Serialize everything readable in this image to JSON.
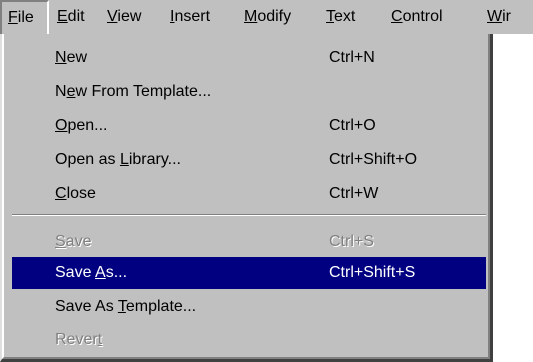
{
  "menubar": {
    "items": [
      {
        "pre": "",
        "key": "F",
        "post": "ile"
      },
      {
        "pre": "",
        "key": "E",
        "post": "dit"
      },
      {
        "pre": "",
        "key": "V",
        "post": "iew"
      },
      {
        "pre": "",
        "key": "I",
        "post": "nsert"
      },
      {
        "pre": "",
        "key": "M",
        "post": "odify"
      },
      {
        "pre": "",
        "key": "T",
        "post": "ext"
      },
      {
        "pre": "",
        "key": "C",
        "post": "ontrol"
      },
      {
        "pre": "",
        "key": "W",
        "post": "ir"
      }
    ]
  },
  "file_menu": {
    "items": [
      {
        "pre": "",
        "key": "N",
        "post": "ew",
        "shortcut": "Ctrl+N"
      },
      {
        "pre": "N",
        "key": "e",
        "post": "w From Template...",
        "shortcut": ""
      },
      {
        "pre": "",
        "key": "O",
        "post": "pen...",
        "shortcut": "Ctrl+O"
      },
      {
        "pre": "Open as ",
        "key": "L",
        "post": "ibrary...",
        "shortcut": "Ctrl+Shift+O"
      },
      {
        "pre": "",
        "key": "C",
        "post": "lose",
        "shortcut": "Ctrl+W"
      },
      {
        "pre": "",
        "key": "S",
        "post": "ave",
        "shortcut": "Ctrl+S"
      },
      {
        "pre": "Save ",
        "key": "A",
        "post": "s...",
        "shortcut": "Ctrl+Shift+S"
      },
      {
        "pre": "Save As ",
        "key": "T",
        "post": "emplate...",
        "shortcut": ""
      },
      {
        "pre": "Rever",
        "key": "t",
        "post": "",
        "shortcut": ""
      }
    ]
  },
  "colors": {
    "menu_face": "#c0c0c0",
    "highlight": "#000080",
    "disabled_text": "#808080"
  }
}
